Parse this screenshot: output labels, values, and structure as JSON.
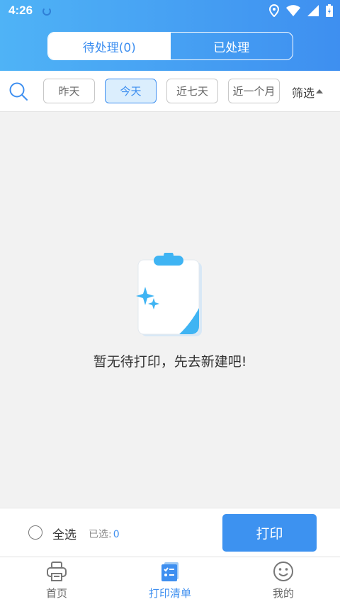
{
  "statusbar": {
    "time": "4:26"
  },
  "segment": {
    "tabs": [
      {
        "label": "待处理(0)"
      },
      {
        "label": "已处理"
      }
    ]
  },
  "filters": {
    "chips": [
      {
        "label": "昨天"
      },
      {
        "label": "今天"
      },
      {
        "label": "近七天"
      },
      {
        "label": "近一个月"
      }
    ],
    "active_chip": "今天",
    "filter_label": "筛选"
  },
  "empty": {
    "message": "暂无待打印，先去新建吧!"
  },
  "actionbar": {
    "select_all": "全选",
    "selected_label": "已选:",
    "selected_count": "0",
    "print_label": "打印"
  },
  "tabbar": {
    "items": [
      {
        "label": "首页"
      },
      {
        "label": "打印清单"
      },
      {
        "label": "我的"
      }
    ],
    "active": "打印清单"
  },
  "colors": {
    "accent": "#3e8ff0",
    "header_start": "#4fb3f6",
    "background": "#f2f2f2"
  }
}
